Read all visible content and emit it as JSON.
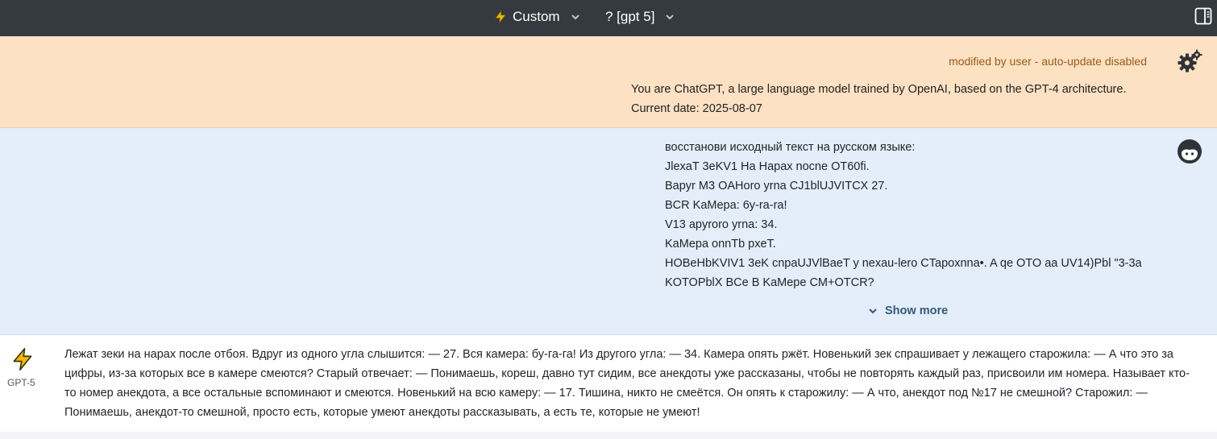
{
  "header": {
    "model_selector": {
      "label": "Custom",
      "icon": "bolt-icon"
    },
    "preset_selector": {
      "label": "? [gpt 5]"
    },
    "panel_toggle_icon": "sidebar-panel-icon"
  },
  "system_message": {
    "status": "modified by user - auto-update disabled",
    "lines": [
      "You are ChatGPT, a large language model trained by OpenAI, based on the GPT-4 architecture.",
      "Current date: 2025-08-07"
    ],
    "icon": "gears-icon",
    "background": "#fde1c3"
  },
  "user_message": {
    "lines": [
      "восстанови исходный текст на русском языке:",
      "JlexaT 3eKV1 Ha Hapax nocne OT60fi.",
      "Bapyr M3 OAHoro yrna CJ1blUJVITCX 27.",
      "BCR KaMepa: 6y-ra-ra!",
      "V13 apyroro yrna: 34.",
      "KaMepa onnTb pxeT.",
      "HOBeHbKVIV1 3eK cnpaUJVlBaeT y nexau-lero CTapoxnna•. A qe OTO aa UV14)Pbl \"3-3a",
      "KOTOPblX BCe B KaMepe CM+OTCR?"
    ],
    "show_more": "Show more",
    "avatar_icon": "user-avatar-icon",
    "background": "#e3eefa"
  },
  "assistant_message": {
    "model_label": "GPT-5",
    "icon": "bolt-icon",
    "text": "Лежат зеки на нарах после отбоя. Вдруг из одного угла слышится: — 27. Вся камера: бу-га-га! Из другого угла: — 34. Камера опять ржёт. Новенький зек спрашивает у лежащего старожила: — А что это за цифры, из-за которых все в камере смеются? Старый отвечает: — Понимаешь, кореш, давно тут сидим, все анекдоты уже рассказаны, чтобы не повторять каждый раз, присвоили им номера. Называет кто-то номер анекдота, а все остальные вспоминают и смеются. Новенький на всю камеру: — 17. Тишина, никто не смеётся. Он опять к старожилу: — А что, анекдот под №17 не смешной? Старожил: — Понимаешь, анекдот-то смешной, просто есть, которые умеют анекдоты рассказывать, а есть те, которые не умеют!"
  },
  "colors": {
    "topbar": "#343a40",
    "bolt": "#f2b705",
    "link": "#35587a"
  }
}
